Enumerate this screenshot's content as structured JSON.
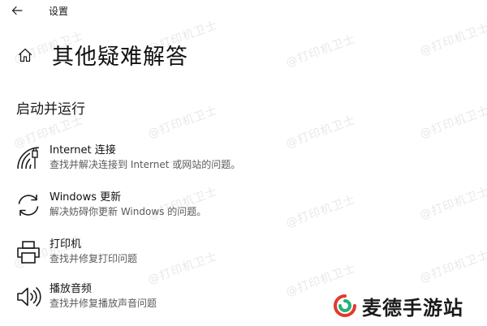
{
  "window": {
    "title": "设置"
  },
  "header": {
    "title": "其他疑难解答"
  },
  "section": {
    "title": "启动并运行"
  },
  "items": [
    {
      "name": "Internet 连接",
      "desc": "查找并解决连接到 Internet 或网站的问题。",
      "icon": "wifi-signal-icon"
    },
    {
      "name": "Windows 更新",
      "desc": "解决妨碍你更新 Windows 的问题。",
      "icon": "refresh-icon"
    },
    {
      "name": "打印机",
      "desc": "查找并修复打印问题",
      "icon": "printer-icon"
    },
    {
      "name": "播放音频",
      "desc": "查找并修复播放声音问题",
      "icon": "speaker-icon"
    }
  ],
  "watermark": {
    "text": "@打印机卫士"
  },
  "brand": {
    "text": "麦德手游站",
    "logo_colors": [
      "#e23a2e",
      "#23b27a"
    ]
  }
}
